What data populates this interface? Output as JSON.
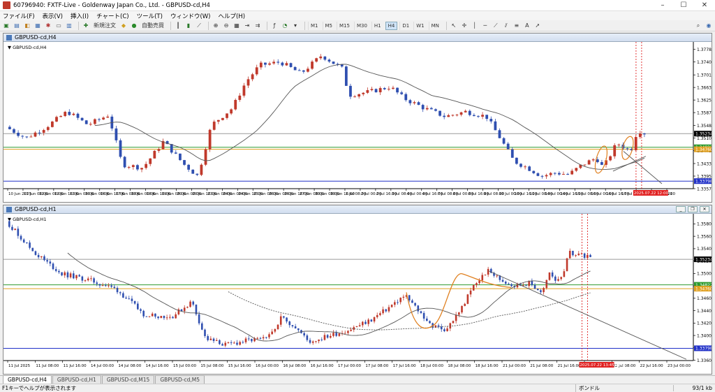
{
  "window": {
    "title": "60796940: FXTF-Live - Goldenway Japan Co., Ltd. - GBPUSD-cd,H4"
  },
  "menu": [
    "ファイル(F)",
    "表示(V)",
    "挿入(I)",
    "チャート(C)",
    "ツール(T)",
    "ウィンドウ(W)",
    "ヘルプ(H)"
  ],
  "toolbar": {
    "new_order": "新規注文",
    "auto_trade": "自動売買",
    "timeframes": [
      "M1",
      "M5",
      "M15",
      "M30",
      "H1",
      "H4",
      "D1",
      "W1",
      "MN"
    ],
    "active_timeframe": "H4"
  },
  "charts": [
    {
      "window_title": "GBPUSD-cd,H4",
      "label": "GBPUSD-cd,H4",
      "y_min": 1.3357,
      "y_max": 1.3788,
      "y_ticks": [
        "1.37780",
        "1.37400",
        "1.37010",
        "1.36630",
        "1.36250",
        "1.35870",
        "1.35480",
        "1.35100",
        "1.34720",
        "1.34330",
        "1.33950",
        "1.33570"
      ],
      "x_ticks": [
        "10 Jun 2025",
        "11 Jun 08:00",
        "12 Jun 00:00",
        "12 Jun 16:00",
        "13 Jun 08:00",
        "16 Jun 00:00",
        "16 Jun 16:00",
        "17 Jun 08:00",
        "18 Jun 00:00",
        "18 Jun 16:00",
        "19 Jun 08:00",
        "20 Jun 00:00",
        "20 Jun 16:00",
        "23 Jun 08:00",
        "24 Jun 00:00",
        "24 Jun 16:00",
        "25 Jun 08:00",
        "26 Jun 00:00",
        "26 Jun 16:00",
        "27 Jun 08:00",
        "30 Jun 00:00",
        "30 Jun 16:00",
        "1 Jul 08:00",
        "2 Jul 00:00",
        "2 Jul 16:00",
        "3 Jul 08:00",
        "4 Jul 00:00",
        "4 Jul 16:00",
        "7 Jul 08:00",
        "8 Jul 00:00",
        "8 Jul 16:00",
        "9 Jul 08:00",
        "10 Jul 00:00",
        "10 Jul 16:00",
        "11 Jul 08:00",
        "14 Jul 00:00",
        "14 Jul 16:00",
        "15 Jul 08:00",
        "16 Jul 00:00",
        "16 Jul 16:00",
        "17 Jul 08:00",
        "18 Jul 00:00",
        "18 Jul 16:00",
        "21"
      ],
      "price_label": "1.35234",
      "price_value": 1.35234,
      "green_label": "1.34822",
      "green_value": 1.34822,
      "orange_label": "1.34760",
      "orange_value": 1.3476,
      "blue_label": "1.33798",
      "blue_value": 1.33798,
      "time_label": "2025.07.22 12:00"
    },
    {
      "window_title": "GBPUSD-cd,H1",
      "label": "GBPUSD-cd,H1",
      "y_min": 1.336,
      "y_max": 1.359,
      "y_ticks": [
        "1.35805",
        "1.35605",
        "1.35405",
        "1.35205",
        "1.35005",
        "1.34805",
        "1.34605",
        "1.34405",
        "1.34205",
        "1.34005",
        "1.33805",
        "1.33605"
      ],
      "x_ticks": [
        "11 Jul 2025",
        "11 Jul 08:00",
        "11 Jul 16:00",
        "14 Jul 00:00",
        "14 Jul 08:00",
        "14 Jul 16:00",
        "15 Jul 00:00",
        "15 Jul 08:00",
        "15 Jul 16:00",
        "16 Jul 00:00",
        "16 Jul 08:00",
        "16 Jul 16:00",
        "17 Jul 00:00",
        "17 Jul 08:00",
        "17 Jul 16:00",
        "18 Jul 00:00",
        "18 Jul 08:00",
        "18 Jul 16:00",
        "21 Jul 00:00",
        "21 Jul 08:00",
        "21 Jul 16:00",
        "22 Jul 00:00",
        "22 Jul 08:00",
        "22 Jul 16:00",
        "23 Jul 00:00"
      ],
      "price_label": "1.35234",
      "price_value": 1.35234,
      "green_label": "1.34822",
      "green_value": 1.34822,
      "orange_label": "1.34760",
      "orange_value": 1.3476,
      "blue_label": "1.33798",
      "blue_value": 1.33798,
      "time_label": "2025.07.22 13:45 17:00"
    }
  ],
  "colors": {
    "bull": "#c0392b",
    "bear": "#2f4fb0",
    "ma": "#555555",
    "green_line": "#2e9a2e",
    "orange_line": "#e0a020",
    "blue_line": "#2030c8",
    "red_dash": "#e02020",
    "pattern": "#e08020"
  },
  "tabs": [
    "GBPUSD-cd,H4",
    "GBPUSD-cd,H1",
    "GBPUSD-cd,M15",
    "GBPUSD-cd,M5"
  ],
  "active_tab": "GBPUSD-cd,H4",
  "status": {
    "help": "F1キーでヘルプが表示されます",
    "profile": "ボンドル",
    "traffic": "93/1 kb"
  }
}
